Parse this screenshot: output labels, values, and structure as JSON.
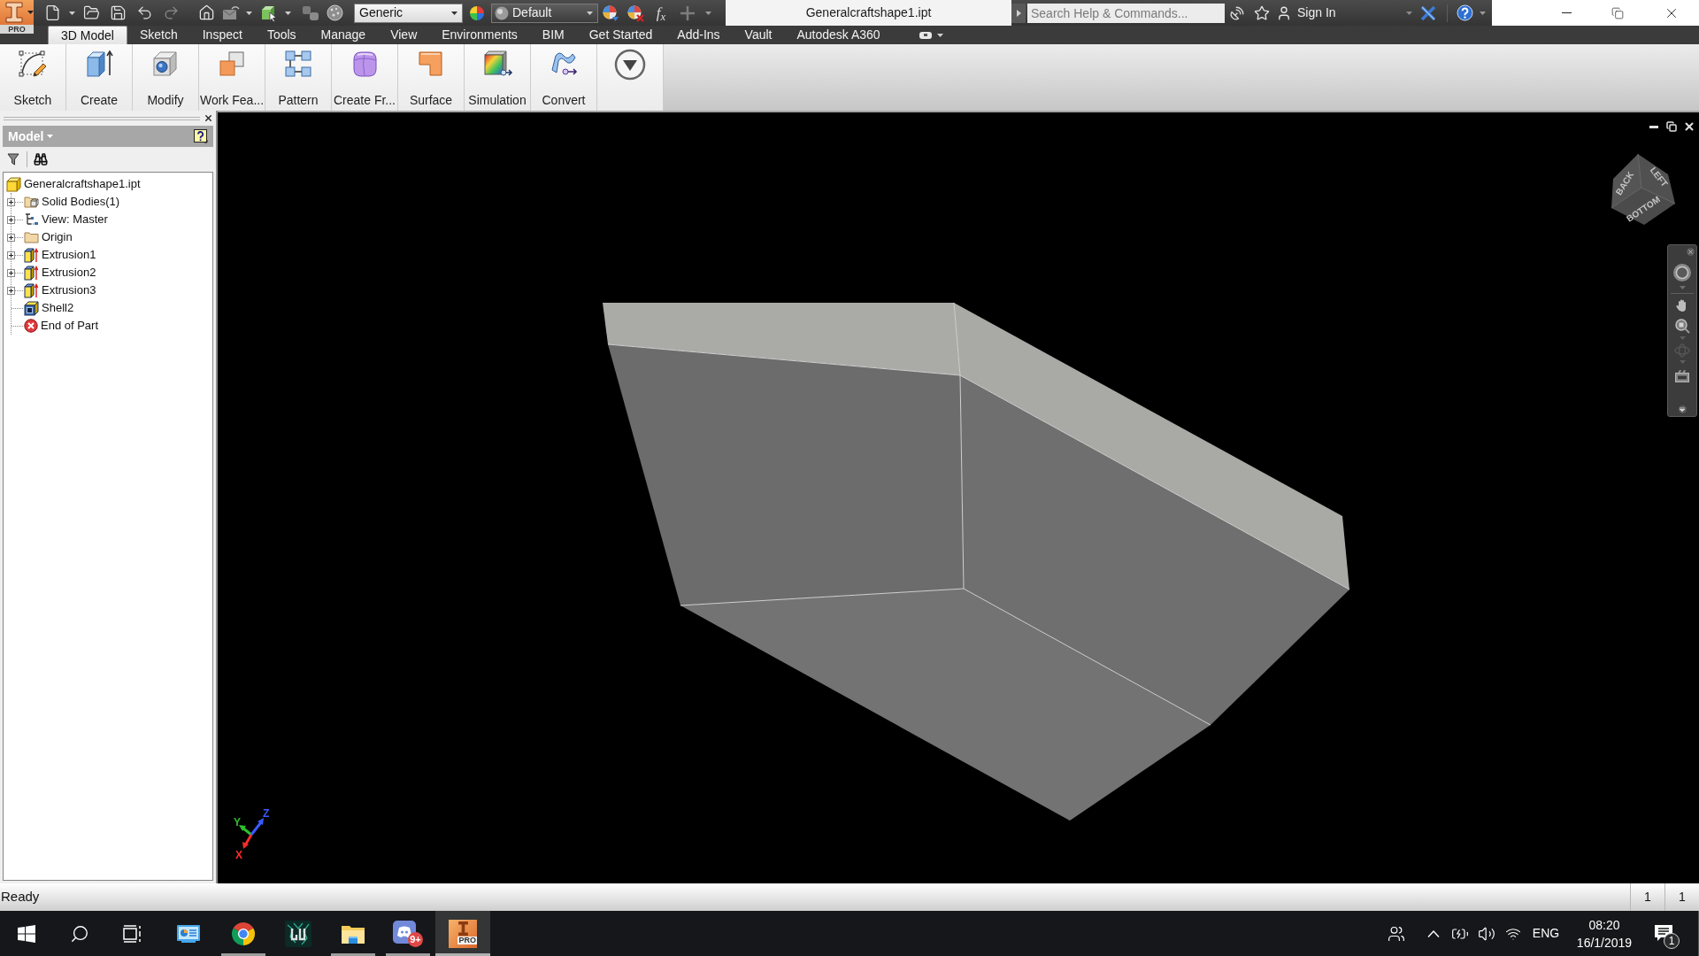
{
  "app_button": {
    "edition": "PRO"
  },
  "quick_access": {
    "material": "Generic",
    "appearance": "Default",
    "parameters": "f$_{x}$"
  },
  "title_bar": {
    "title": "Generalcraftshape1.ipt",
    "search": {
      "placeholder": "Search Help & Commands..."
    },
    "sign_in": "Sign In"
  },
  "tabs": [
    {
      "label": "3D Model",
      "selected": true
    },
    {
      "label": "Sketch",
      "selected": false
    },
    {
      "label": "Inspect",
      "selected": false
    },
    {
      "label": "Tools",
      "selected": false
    },
    {
      "label": "Manage",
      "selected": false
    },
    {
      "label": "View",
      "selected": false
    },
    {
      "label": "Environments",
      "selected": false
    },
    {
      "label": "BIM",
      "selected": false
    },
    {
      "label": "Get Started",
      "selected": false
    },
    {
      "label": "Add-Ins",
      "selected": false
    },
    {
      "label": "Vault",
      "selected": false
    },
    {
      "label": "Autodesk A360",
      "selected": false
    }
  ],
  "ribbon": {
    "buttons": [
      {
        "label": "Sketch",
        "kind": "sketch"
      },
      {
        "label": "Create",
        "kind": "create"
      },
      {
        "label": "Modify",
        "kind": "modify"
      },
      {
        "label": "Work Fea...",
        "kind": "work-features"
      },
      {
        "label": "Pattern",
        "kind": "pattern"
      },
      {
        "label": "Create Fr...",
        "kind": "freeform"
      },
      {
        "label": "Surface",
        "kind": "surface"
      },
      {
        "label": "Simulation",
        "kind": "simulation"
      },
      {
        "label": "Convert",
        "kind": "convert"
      },
      {
        "kind": "more"
      }
    ]
  },
  "browser": {
    "title": "Model",
    "tree": [
      {
        "label": "Generalcraftshape1.ipt",
        "kind": "part",
        "children": [
          {
            "label": "Solid Bodies(1)",
            "kind": "solid-bodies",
            "expanded": false
          },
          {
            "label": "View: Master",
            "kind": "view",
            "expanded": false
          },
          {
            "label": "Origin",
            "kind": "folder",
            "expanded": false
          },
          {
            "label": "Extrusion1",
            "kind": "extrusion",
            "expanded": false
          },
          {
            "label": "Extrusion2",
            "kind": "extrusion",
            "expanded": false
          },
          {
            "label": "Extrusion3",
            "kind": "extrusion",
            "expanded": false
          },
          {
            "label": "Shell2",
            "kind": "shell"
          },
          {
            "label": "End of Part",
            "kind": "end-of-part"
          }
        ]
      }
    ]
  },
  "viewport": {
    "view_cube": {
      "faces": [
        "BACK",
        "LEFT",
        "BOTTOM"
      ]
    },
    "axes": [
      {
        "label": "Y",
        "color": "#2fbf2f"
      },
      {
        "label": "Z",
        "color": "#3a5cff"
      },
      {
        "label": "X",
        "color": "#ff2b2b"
      }
    ]
  },
  "status_bar": {
    "text": "Ready",
    "counters": [
      "1",
      "1"
    ]
  },
  "taskbar": {
    "apps": [
      {
        "kind": "control-panel",
        "running": false,
        "selected": false
      },
      {
        "kind": "chrome",
        "running": true,
        "selected": false
      },
      {
        "kind": "game",
        "running": false,
        "selected": false
      },
      {
        "kind": "explorer",
        "running": true,
        "selected": false
      },
      {
        "kind": "discord",
        "running": true,
        "selected": false,
        "badge": "9+"
      },
      {
        "kind": "inventor",
        "running": true,
        "selected": true,
        "badge": "PRO"
      }
    ],
    "language": "ENG",
    "time": "08:20",
    "date": "16/1/2019",
    "notifications": "1"
  }
}
